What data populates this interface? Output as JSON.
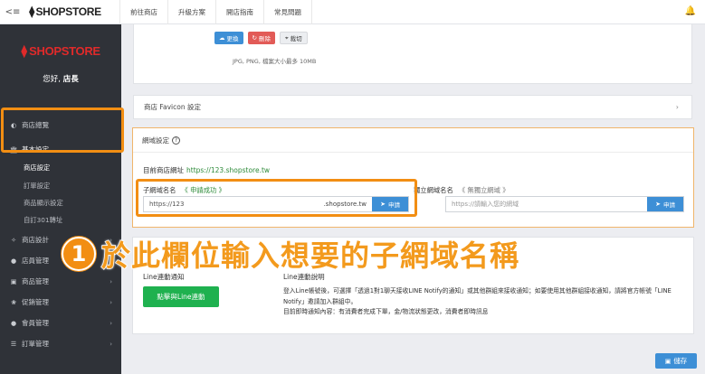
{
  "topbar": {
    "menu_icon": "sidebar-toggle-icon",
    "brand": "SHOPSTORE",
    "nav": [
      "前往商店",
      "升級方案",
      "開店指南",
      "常見問題"
    ],
    "bell_icon": "bell-icon"
  },
  "sidebar": {
    "brand": "SHOPSTORE",
    "greeting_prefix": "您好,",
    "greeting_name": "店長",
    "items": [
      {
        "label": "商店總覽",
        "icon": "dashboard-icon"
      },
      {
        "label": "基本設定",
        "icon": "bank-icon"
      },
      {
        "label": "商店設定"
      },
      {
        "label": "訂單設定"
      },
      {
        "label": "商品顯示設定"
      },
      {
        "label": "自訂301轉址"
      },
      {
        "label": "商店設計",
        "icon": "wrench-icon"
      },
      {
        "label": "店員管理",
        "icon": "user-icon"
      },
      {
        "label": "商品管理",
        "icon": "cart-icon"
      },
      {
        "label": "促銷管理",
        "icon": "gift-icon"
      },
      {
        "label": "會員管理",
        "icon": "users-icon"
      },
      {
        "label": "訂單管理",
        "icon": "list-icon"
      }
    ]
  },
  "logo_section": {
    "replace": "更換",
    "remove": "刪除",
    "crop": "裁切",
    "hint": "JPG, PNG, 檔案大小最多 10MB"
  },
  "favicon": {
    "label": "商店 Favicon 設定"
  },
  "domain": {
    "heading": "網域設定",
    "current_label": "目前商店網址",
    "current_url": "https://123.shopstore.tw",
    "sub_label": "子網域名名",
    "sub_status": "《 申請成功 》",
    "sub_value": "https://123",
    "sub_suffix": ".shopstore.tw",
    "apply": "申請",
    "own_label": "獨立網域名名",
    "own_status": "《 無獨立網域 》",
    "own_placeholder": "https://請輸入您的網域"
  },
  "line": {
    "title": "Line連動通知",
    "button": "點擊與Line連動",
    "desc_title": "Line連動說明",
    "desc_1": "登入Line帳號後，可選擇「透過1對1聊天接收LINE Notify的通知」或其他群組來接收通知；如要使用其他群組接收通知，請將官方帳號「LINE Notify」邀請加入群組中。",
    "desc_2": "目前即時通知內容：有消費者完成下單，金/物流狀態更改，消費者即時訊息"
  },
  "annotation": {
    "number": "1",
    "text": "於此欄位輸入想要的子網域名稱"
  },
  "save": "儲存"
}
